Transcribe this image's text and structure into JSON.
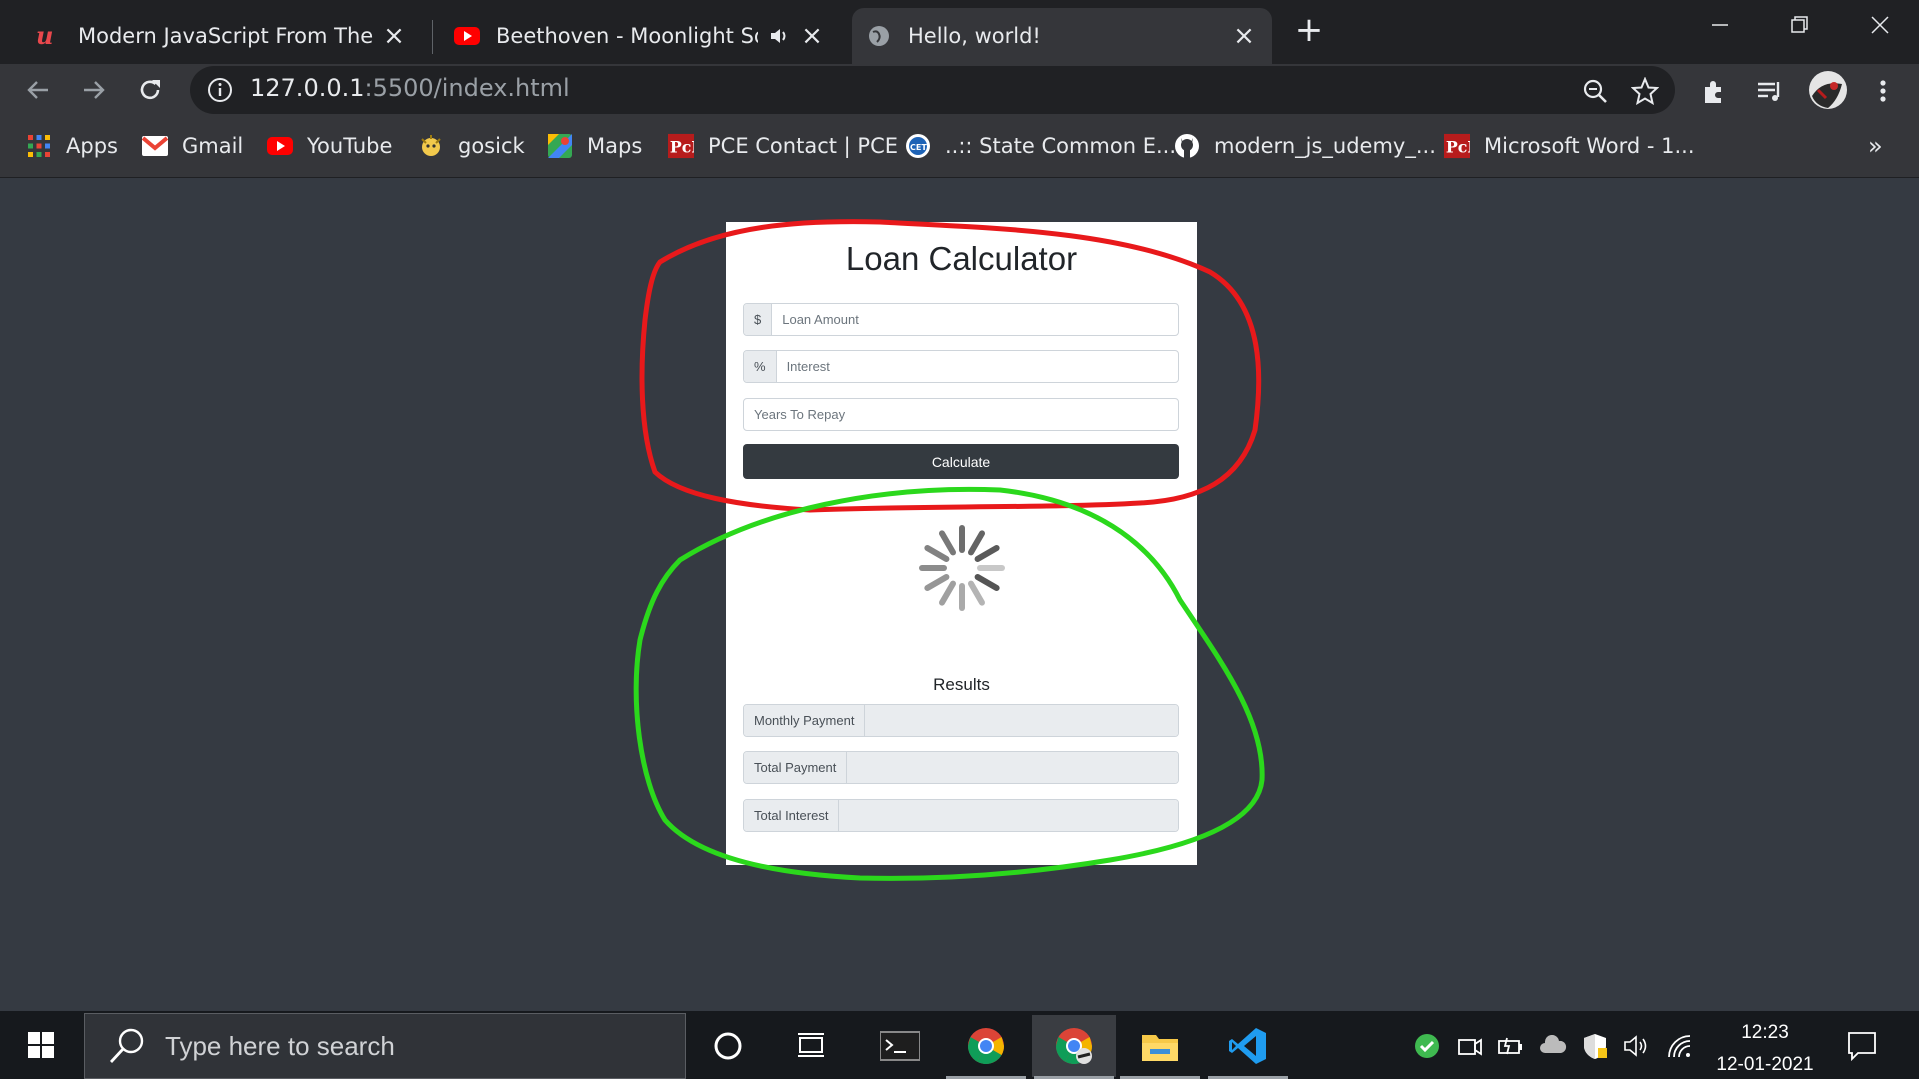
{
  "browser": {
    "tabs": [
      {
        "title": "Modern JavaScript From The Beg",
        "favicon": "udemy-icon"
      },
      {
        "title": "Beethoven - Moonlight Sona",
        "favicon": "youtube-icon",
        "audio": "speaker-icon"
      },
      {
        "title": "Hello, world!",
        "favicon": "globe-icon"
      }
    ],
    "url_host": "127.0.0.1",
    "url_rest": ":5500/index.html",
    "bookmarks": [
      {
        "label": "Apps",
        "icon": "apps-grid-icon"
      },
      {
        "label": "Gmail",
        "icon": "gmail-icon"
      },
      {
        "label": "YouTube",
        "icon": "youtube-icon"
      },
      {
        "label": "gosick",
        "icon": "gosick-icon"
      },
      {
        "label": "Maps",
        "icon": "maps-icon"
      },
      {
        "label": "PCE Contact | PCE",
        "icon": "pce-icon"
      },
      {
        "label": "..:: State Common E...",
        "icon": "cet-icon"
      },
      {
        "label": "modern_js_udemy_...",
        "icon": "github-icon"
      },
      {
        "label": "Microsoft Word - 1...",
        "icon": "pce-icon"
      }
    ],
    "more_bookmarks": "»"
  },
  "page": {
    "title": "Loan Calculator",
    "amount": {
      "addon": "$",
      "placeholder": "Loan Amount"
    },
    "interest": {
      "addon": "%",
      "placeholder": "Interest"
    },
    "years": {
      "placeholder": "Years To Repay"
    },
    "calculate_label": "Calculate",
    "results_title": "Results",
    "results": [
      {
        "label": "Monthly Payment",
        "value": ""
      },
      {
        "label": "Total Payment",
        "value": ""
      },
      {
        "label": "Total Interest",
        "value": ""
      }
    ],
    "annotation_colors": {
      "inputs": "#e8191b",
      "results": "#2bd81c"
    }
  },
  "taskbar": {
    "search_placeholder": "Type here to search",
    "time": "12:23",
    "date": "12-01-2021"
  }
}
